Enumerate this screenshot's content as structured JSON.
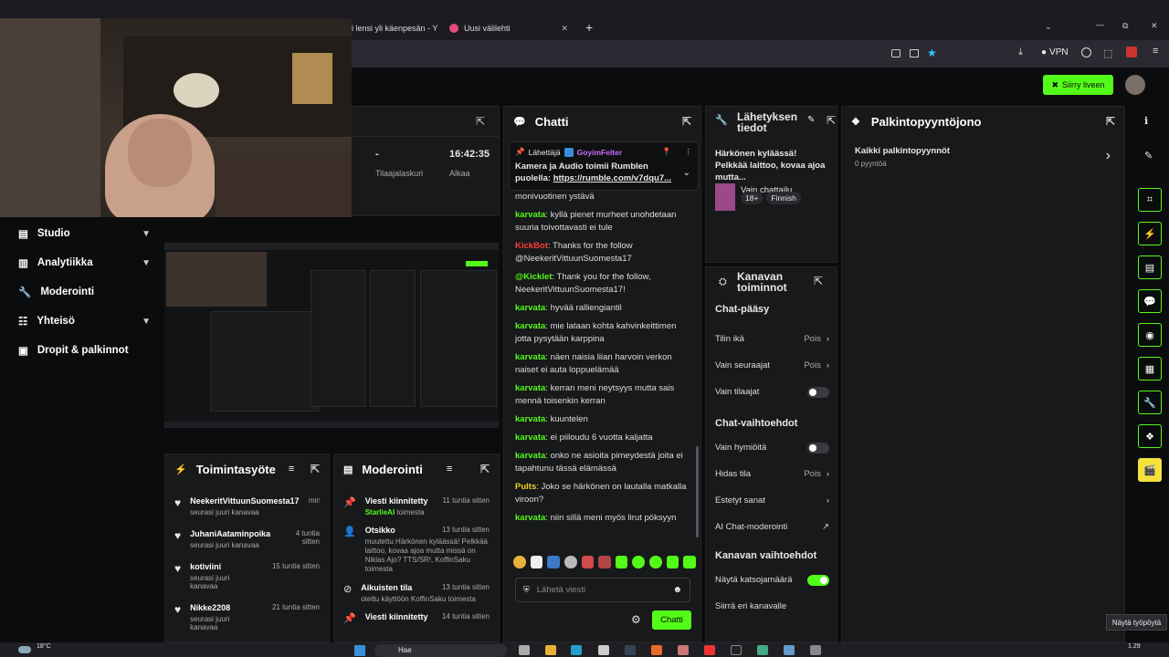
{
  "browser": {
    "tabs": [
      {
        "label": "i lensi yli käenpesän - Y"
      },
      {
        "label": "Uusi välilehti"
      }
    ],
    "new_tab": "+",
    "vpn_label": "VPN",
    "win_min": "—",
    "win_max": "⧉",
    "win_close": "✕"
  },
  "appbar": {
    "live_button": "Siirry liveen"
  },
  "stats": {
    "col1_value": "-",
    "col1_label": "Tilaajalaskuri",
    "col2_value": "16:42:35",
    "col2_label": "Alkaa"
  },
  "sidebar": {
    "items": [
      {
        "label": "Studio",
        "chev": true
      },
      {
        "label": "Analytiikka",
        "chev": true
      },
      {
        "label": "Moderointi",
        "chev": false
      },
      {
        "label": "Yhteisö",
        "chev": true
      },
      {
        "label": "Dropit & palkinnot",
        "chev": false
      }
    ]
  },
  "chat": {
    "title": "Chatti",
    "pinned_by": "Lähettäjä",
    "pinned_user": "GoyimFelter",
    "pinned_text": "Kamera ja Audio toimii Rumblen puolella:",
    "pinned_link": "https://rumble.com/v7dqu7...",
    "partial_line": "monivuotinen ystävä",
    "messages": [
      {
        "user": "karvata",
        "text": "kyllä pienet murheet unohdetaan suuria toivottavasti ei tule",
        "color": "#53fc18"
      },
      {
        "user": "KickBot",
        "text": "Thanks for the follow @NeekeritVittuunSuomesta17",
        "color": "#ff3b3b"
      },
      {
        "user": "@Kicklet",
        "text": "Thank you for the follow, NeekeritVittuunSuomesta17!",
        "color": "#53fc18"
      },
      {
        "user": "karvata",
        "text": "hyvää ralliengiantil",
        "color": "#53fc18"
      },
      {
        "user": "karvata",
        "text": "mie lataan kohta kahvinkeittimen jotta pysytään karppina",
        "color": "#53fc18"
      },
      {
        "user": "karvata",
        "text": "näen naisia liian harvoin verkon naiset ei auta loppuelämää",
        "color": "#53fc18"
      },
      {
        "user": "karvata",
        "text": "kerran meni neytsyys mutta sais mennä toisenkin kerran",
        "color": "#53fc18"
      },
      {
        "user": "karvata",
        "text": "kuuntelen",
        "color": "#53fc18"
      },
      {
        "user": "karvata",
        "text": "ei piiloudu 6 vuotta kaljatta",
        "color": "#53fc18"
      },
      {
        "user": "karvata",
        "text": "onko ne asioita pimeydestä joita ei tapahtunu tässä elämässä",
        "color": "#53fc18"
      },
      {
        "user": "Pults",
        "text": "Joko se härkönen on lautalla matkalla viroon?",
        "color": "#f0d020"
      },
      {
        "user": "karvata",
        "text": "niin sillä meni myös lirut pöksyyn",
        "color": "#53fc18"
      }
    ],
    "input_placeholder": "Lähetä viesti",
    "send_button": "Chatti"
  },
  "stream_info": {
    "title": "Lähetyksen tiedot",
    "stream_title": "Härkönen kyläässä! Pelkkää laittoo, kovaa ajoa mutta...",
    "category": "Vain chattailu",
    "tag1": "18+",
    "tag2": "Finnish"
  },
  "channel_actions": {
    "title": "Kanavan toiminnot",
    "section1": "Chat-pääsy",
    "account_age": {
      "label": "Tilin ikä",
      "value": "Pois"
    },
    "followers_only": {
      "label": "Vain seuraajat",
      "value": "Pois"
    },
    "subs_only": {
      "label": "Vain tilaajat"
    },
    "section2": "Chat-vaihtoehdot",
    "emotes_only": {
      "label": "Vain hymiöitä"
    },
    "slow_mode": {
      "label": "Hidas tila",
      "value": "Pois"
    },
    "banned_words": {
      "label": "Estetyt sanat"
    },
    "ai_mod": {
      "label": "AI Chat-moderointi"
    },
    "section3": "Kanavan vaihtoehdot",
    "show_viewers": {
      "label": "Näytä katsojamäärä"
    },
    "move_channel": {
      "label": "Siirrä eri kanavalle"
    }
  },
  "rewards": {
    "title": "Palkintopyyntöjono",
    "all": "Kaikki palkintopyynnöt",
    "count": "0 pyyntöä"
  },
  "activity": {
    "title": "Toimintasyöte",
    "items": [
      {
        "name": "NeekeritVittuunSuomesta17",
        "sub": "seurasi juuri kanavaa",
        "time": "minu"
      },
      {
        "name": "JuhaniAataminpoika",
        "sub": "seurasi juuri kanavaa",
        "time": "4 tuntia sitten"
      },
      {
        "name": "kotiviini",
        "sub": "seurasi juuri kanavaa",
        "time": "15 tuntia sitten"
      },
      {
        "name": "Nikke2208",
        "sub": "seurasi juuri kanavaa",
        "time": "21 tuntia sitten"
      }
    ]
  },
  "moderation": {
    "title": "Moderointi",
    "items": [
      {
        "title": "Viesti kiinnitetty",
        "time": "11 tuntia sitten",
        "sub": "StarlieAI",
        "sub2": " toimesta"
      },
      {
        "title": "Otsikko",
        "time": "13 tuntia sitten",
        "sub": "muutettu Härkönen kyläässä! Pelkkää laittoo, kovaa ajoa mutta missä on Niklas Ajo? TTS/SR!, KoffinSaku toimesta",
        "sub2": ""
      },
      {
        "title": "Aikuisten tila",
        "time": "13 tuntia sitten",
        "sub": "otettu käyttöön KoffinSaku toimesta",
        "sub2": ""
      },
      {
        "title": "Viesti kiinnitetty",
        "time": "14 tuntia sitten",
        "sub": "",
        "sub2": ""
      }
    ]
  },
  "tooltip": "Näytä työpöytä",
  "taskbar": {
    "temp": "18°C",
    "search": "Hae",
    "clock": "1.29"
  },
  "colors": {
    "accent": "#53fc18",
    "panel": "#18191b",
    "bg": "#0b0c0d"
  }
}
